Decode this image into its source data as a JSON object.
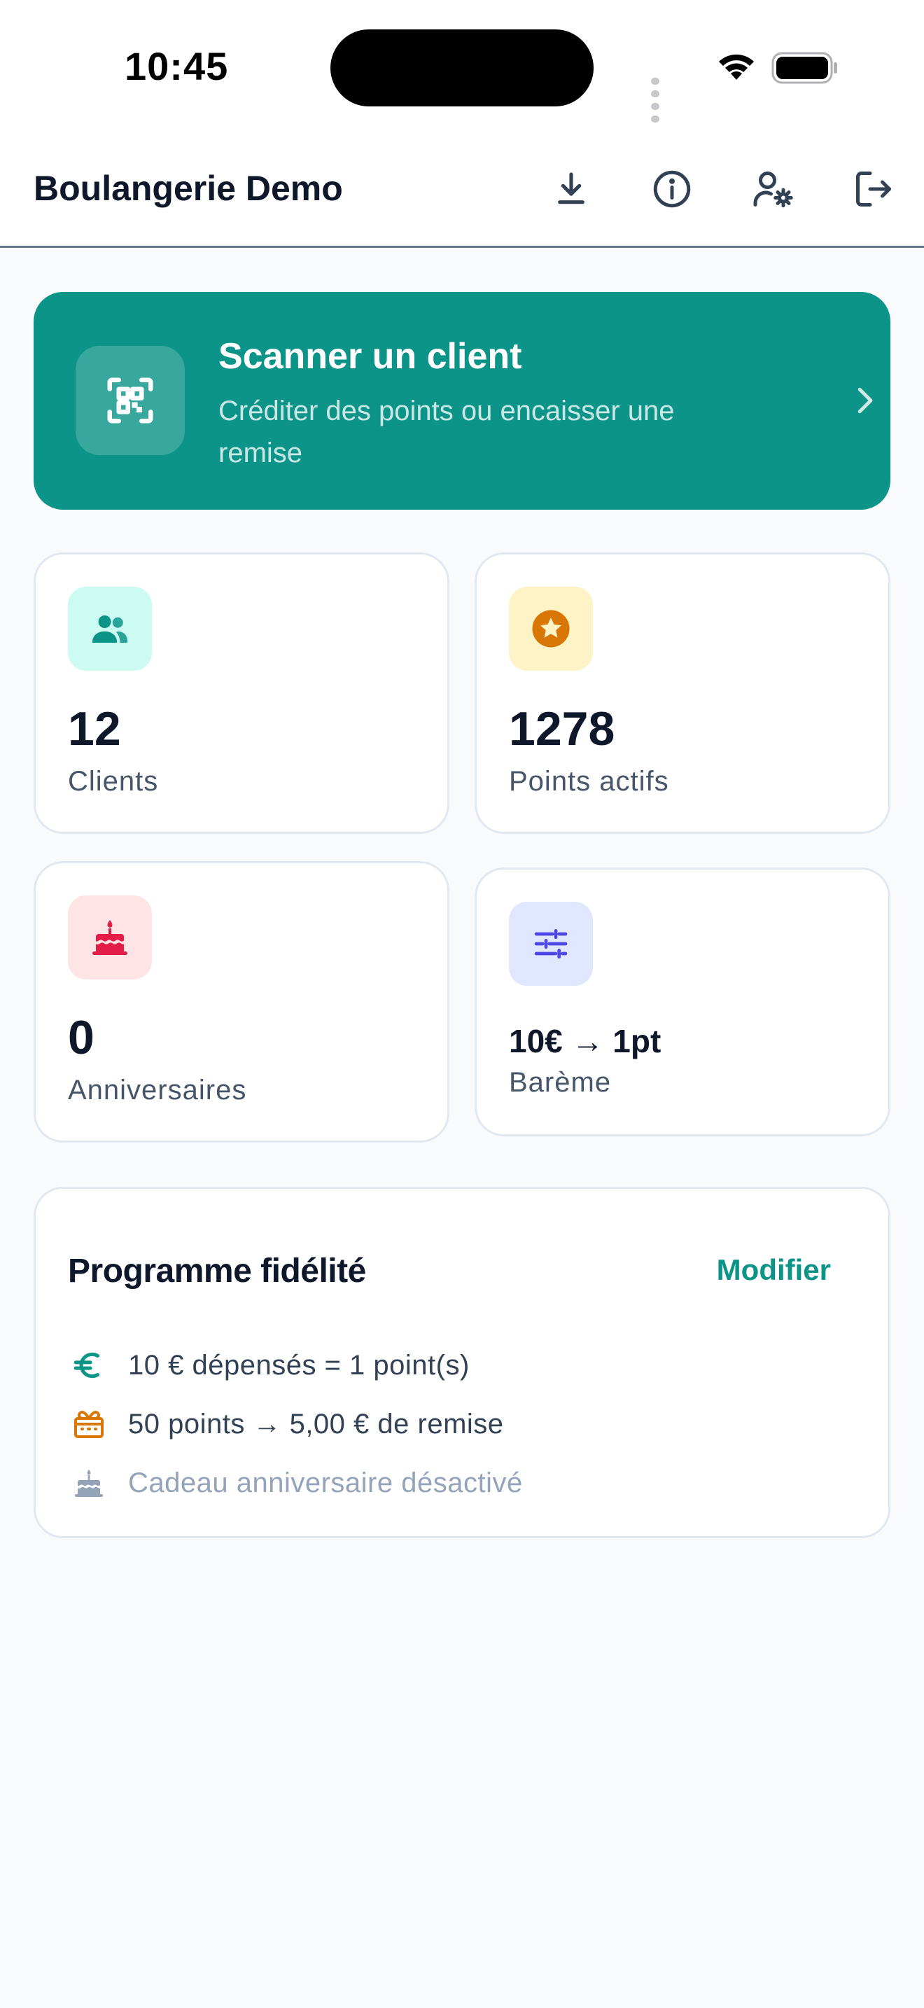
{
  "status_bar": {
    "time": "10:45"
  },
  "header": {
    "title": "Boulangerie Demo",
    "actions": [
      "download-icon",
      "info-icon",
      "user-settings-icon",
      "logout-icon"
    ]
  },
  "scan_card": {
    "title": "Scanner un client",
    "subtitle": "Créditer des points ou encaisser une remise",
    "icon": "qr-code-scan-icon"
  },
  "stats": [
    {
      "value": "12",
      "label": "Clients",
      "icon": "users-icon",
      "icon_color": "#0d9488",
      "icon_bg": "#ccfbf1"
    },
    {
      "value": "1278",
      "label": "Points actifs",
      "icon": "star-badge-icon",
      "icon_color": "#d97706",
      "icon_bg": "#fef3c7"
    },
    {
      "value": "0",
      "label": "Anniversaires",
      "icon": "cake-icon",
      "icon_color": "#e11d48",
      "icon_bg": "#ffe4e6"
    },
    {
      "value": "10€ → 1pt",
      "label": "Barème",
      "icon": "sliders-icon",
      "icon_color": "#4f46e5",
      "icon_bg": "#e0e7ff"
    }
  ],
  "loyalty": {
    "title": "Programme fidélité",
    "edit_label": "Modifier",
    "rules": [
      {
        "text": "10 € dépensés = 1 point(s)",
        "icon": "euro-icon",
        "color": "#0d9488",
        "enabled": true
      },
      {
        "text": "50 points → 5,00 € de remise",
        "icon": "gift-icon",
        "color": "#d97706",
        "enabled": true
      },
      {
        "text": "Cadeau anniversaire désactivé",
        "icon": "cake-icon",
        "color": "#94a3b8",
        "enabled": false
      }
    ]
  },
  "colors": {
    "accent": "#0d9488",
    "background": "#f8fafc",
    "card_border": "#e2e8f0"
  }
}
